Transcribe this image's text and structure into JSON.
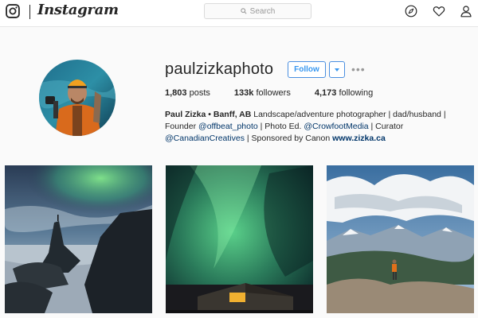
{
  "app": {
    "name": "Instagram"
  },
  "search": {
    "placeholder": "Search"
  },
  "nav": {
    "icons": [
      "compass-icon",
      "heart-icon",
      "person-icon"
    ]
  },
  "profile": {
    "username": "paulzizkaphoto",
    "follow_label": "Follow",
    "more_label": "•••",
    "stats": {
      "posts_count": "1,803",
      "posts_label": "posts",
      "followers_count": "133k",
      "followers_label": "followers",
      "following_count": "4,173",
      "following_label": "following"
    },
    "bio": {
      "name": "Paul Zizka • Banff, AB",
      "line1_rest": "Landscape/adventure photographer | dad/husband |",
      "line2_a": "Founder ",
      "mention1": "@offbeat_photo",
      "line2_b": " | Photo Ed. ",
      "mention2": "@CrowfootMedia",
      "line2_c": " | Curator",
      "mention3": "@CanadianCreatives",
      "line3_b": " | Sponsored by Canon ",
      "website": "www.zizka.ca"
    }
  },
  "colors": {
    "link": "#003569",
    "accent": "#3897f0",
    "border": "#dbdbdb",
    "background": "#fafafa"
  },
  "posts": [
    {
      "subject": "aurora over sea stack"
    },
    {
      "subject": "aurora over tent"
    },
    {
      "subject": "hiker on mountain summit"
    }
  ]
}
